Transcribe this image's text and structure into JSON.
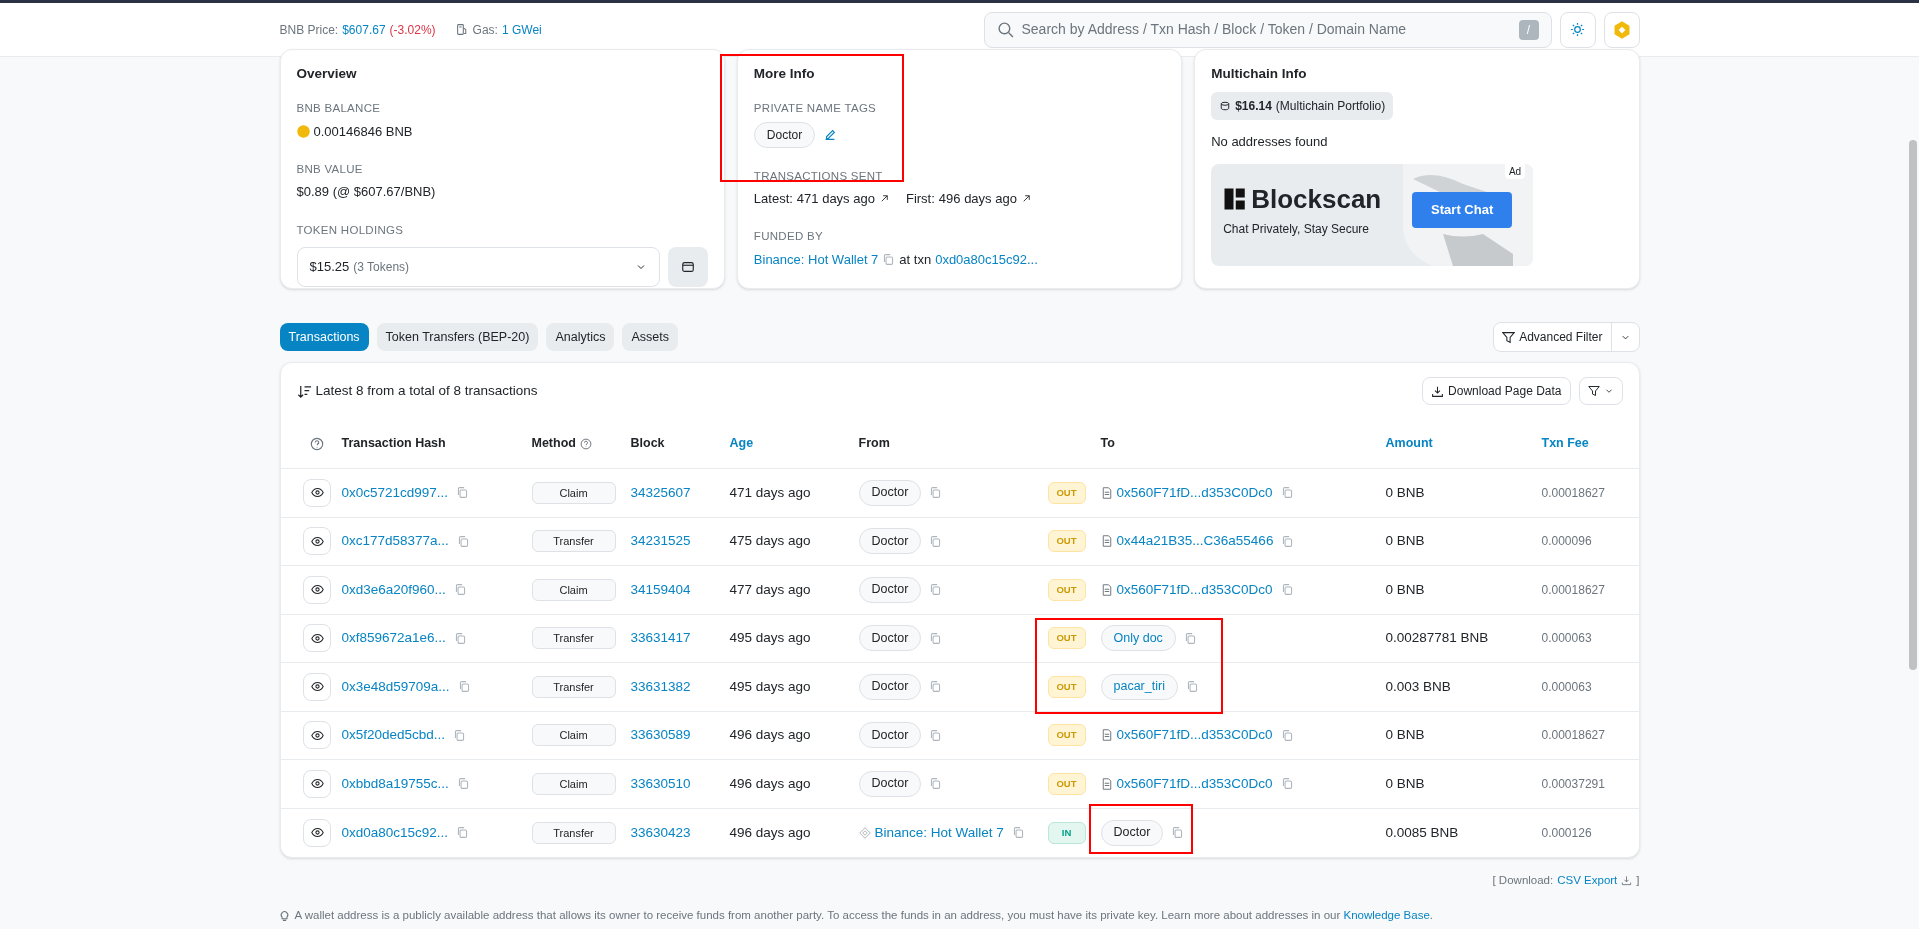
{
  "header": {
    "price_label": "BNB Price:",
    "price": "$607.67",
    "price_change": "(-3.02%)",
    "gas_label": "Gas:",
    "gas": "1 GWei",
    "search": {
      "placeholder": "Search by Address / Txn Hash / Block / Token / Domain Name"
    },
    "search_key": "/"
  },
  "overview": {
    "title": "Overview",
    "balance_label": "BNB BALANCE",
    "balance": "0.00146846 BNB",
    "value_label": "BNB VALUE",
    "value": "$0.89 (@ $607.67/BNB)",
    "holdings_label": "TOKEN HOLDINGS",
    "holdings_value": "$15.25",
    "holdings_count": "(3 Tokens)"
  },
  "more_info": {
    "title": "More Info",
    "name_tags_label": "PRIVATE NAME TAGS",
    "name_tag": "Doctor",
    "highlighted": true,
    "tx_sent_label": "TRANSACTIONS SENT",
    "latest_label": "Latest:",
    "latest": "471 days ago",
    "first_label": "First:",
    "first": "496 days ago",
    "funded_label": "FUNDED BY",
    "funded_by": "Binance: Hot Wallet 7",
    "at_txn": "at txn",
    "txn": "0xd0a80c15c92..."
  },
  "multichain": {
    "title": "Multichain Info",
    "portfolio_value": "$16.14",
    "portfolio_label": "(Multichain Portfolio)",
    "no_addresses": "No addresses found",
    "ad": {
      "badge": "Ad",
      "brand": "Blockscan",
      "tagline": "Chat Privately, Stay Secure",
      "button": "Start Chat"
    }
  },
  "tabs": [
    {
      "label": "Transactions",
      "selected": true
    },
    {
      "label": "Token Transfers (BEP-20)",
      "selected": false
    },
    {
      "label": "Analytics",
      "selected": false
    },
    {
      "label": "Assets",
      "selected": false
    }
  ],
  "advanced_filter": "Advanced Filter",
  "table": {
    "summary": "Latest 8 from a total of 8 transactions",
    "download": "Download Page Data",
    "columns": [
      {
        "label": "Transaction Hash",
        "sortable": false
      },
      {
        "label": "Method",
        "sortable": false
      },
      {
        "label": "Block",
        "sortable": false
      },
      {
        "label": "Age",
        "sortable": true
      },
      {
        "label": "From",
        "sortable": false
      },
      {
        "label": "To",
        "sortable": false
      },
      {
        "label": "Amount",
        "sortable": true
      },
      {
        "label": "Txn Fee",
        "sortable": true
      }
    ],
    "rows": [
      {
        "hash": "0x0c5721cd997...",
        "method": "Claim",
        "block": "34325607",
        "age": "471 days ago",
        "from": {
          "text": "Doctor",
          "kind": "tag"
        },
        "direction": "OUT",
        "to": {
          "text": "0x560F71fD...d353C0Dc0",
          "kind": "contract"
        },
        "amount": "0 BNB",
        "fee": "0.00018627",
        "highlighted": false
      },
      {
        "hash": "0xc177d58377a...",
        "method": "Transfer",
        "block": "34231525",
        "age": "475 days ago",
        "from": {
          "text": "Doctor",
          "kind": "tag"
        },
        "direction": "OUT",
        "to": {
          "text": "0x44a21B35...C36a55466",
          "kind": "contract"
        },
        "amount": "0 BNB",
        "fee": "0.000096",
        "highlighted": false
      },
      {
        "hash": "0xd3e6a20f960...",
        "method": "Claim",
        "block": "34159404",
        "age": "477 days ago",
        "from": {
          "text": "Doctor",
          "kind": "tag"
        },
        "direction": "OUT",
        "to": {
          "text": "0x560F71fD...d353C0Dc0",
          "kind": "contract"
        },
        "amount": "0 BNB",
        "fee": "0.00018627",
        "highlighted": false
      },
      {
        "hash": "0xf859672a1e6...",
        "method": "Transfer",
        "block": "33631417",
        "age": "495 days ago",
        "from": {
          "text": "Doctor",
          "kind": "tag"
        },
        "direction": "OUT",
        "to": {
          "text": "Only doc",
          "kind": "link_tag"
        },
        "amount": "0.00287781 BNB",
        "fee": "0.000063",
        "highlighted": true
      },
      {
        "hash": "0x3e48d59709a...",
        "method": "Transfer",
        "block": "33631382",
        "age": "495 days ago",
        "from": {
          "text": "Doctor",
          "kind": "tag"
        },
        "direction": "OUT",
        "to": {
          "text": "pacar_tiri",
          "kind": "link_tag"
        },
        "amount": "0.003 BNB",
        "fee": "0.000063",
        "highlighted": true
      },
      {
        "hash": "0x5f20ded5cbd...",
        "method": "Claim",
        "block": "33630589",
        "age": "496 days ago",
        "from": {
          "text": "Doctor",
          "kind": "tag"
        },
        "direction": "OUT",
        "to": {
          "text": "0x560F71fD...d353C0Dc0",
          "kind": "contract"
        },
        "amount": "0 BNB",
        "fee": "0.00018627",
        "highlighted": false
      },
      {
        "hash": "0xbbd8a19755c...",
        "method": "Claim",
        "block": "33630510",
        "age": "496 days ago",
        "from": {
          "text": "Doctor",
          "kind": "tag"
        },
        "direction": "OUT",
        "to": {
          "text": "0x560F71fD...d353C0Dc0",
          "kind": "contract"
        },
        "amount": "0 BNB",
        "fee": "0.00037291",
        "highlighted": false
      },
      {
        "hash": "0xd0a80c15c92...",
        "method": "Transfer",
        "block": "33630423",
        "age": "496 days ago",
        "from": {
          "text": "Binance: Hot Wallet 7",
          "kind": "exchange"
        },
        "direction": "IN",
        "to": {
          "text": "Doctor",
          "kind": "tag",
          "highlighted": true
        },
        "amount": "0.0085 BNB",
        "fee": "0.000126",
        "highlighted": false
      }
    ]
  },
  "footer": {
    "download_open": "[ Download:",
    "csv": "CSV Export",
    "download_close": "]",
    "note": "A wallet address is a publicly available address that allows its owner to receive funds from another party. To access the funds in an address, you must have its private key. Learn more about addresses in our",
    "note_link": "Knowledge Base",
    "note_end": "."
  }
}
